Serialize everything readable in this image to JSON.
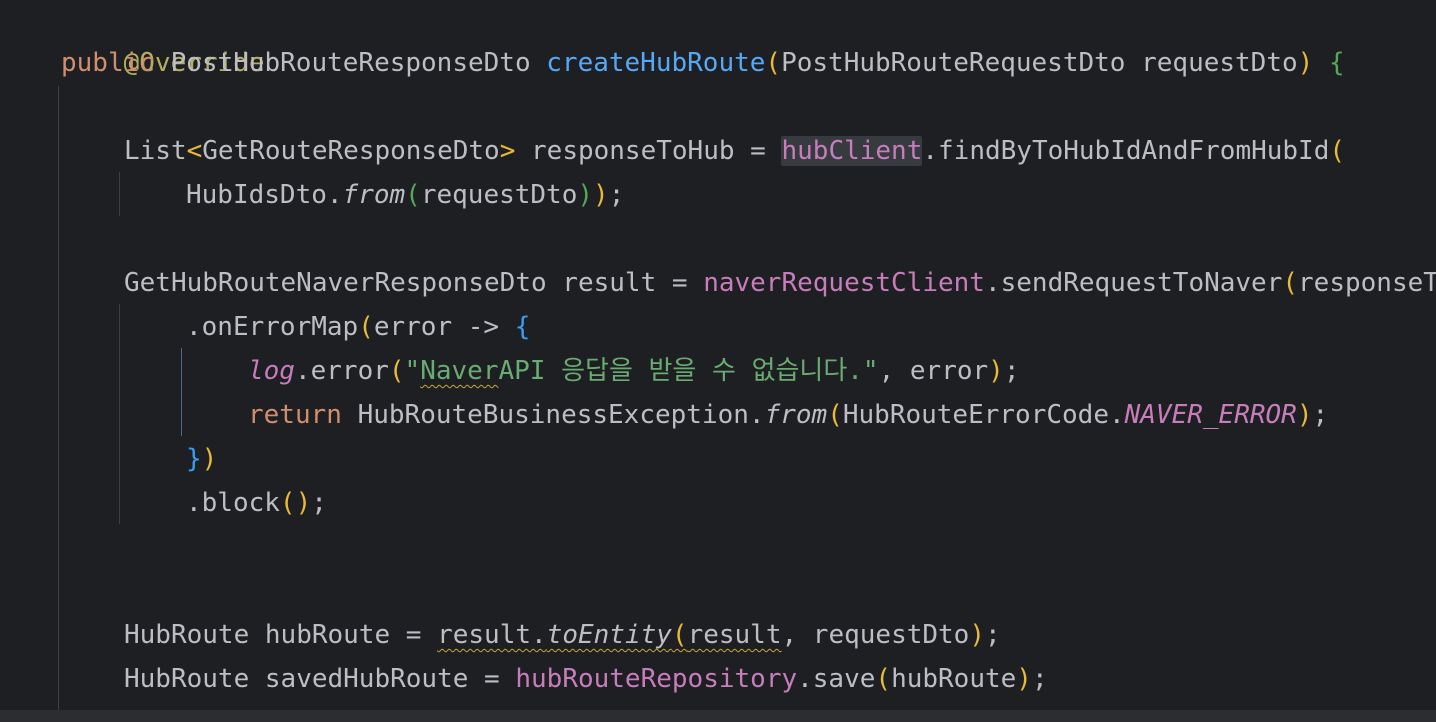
{
  "code": {
    "annotation": "@Override",
    "kw_public": "public",
    "kw_return": "return",
    "method_decl": {
      "return_type": "PostHubRouteResponseDto",
      "name": "createHubRoute",
      "param_type": "PostHubRouteRequestDto",
      "param_name": "requestDto"
    },
    "list_stmt": {
      "list_type": "List",
      "generic_type": "GetRouteResponseDto",
      "var_name": "responseToHub",
      "assign": "=",
      "client_field": "hubClient",
      "method": ".findByToHubIdAndFromHubId",
      "arg_class": "HubIdsDto.",
      "arg_static": "from",
      "arg_param": "requestDto"
    },
    "result_stmt": {
      "type": "GetHubRouteNaverResponseDto",
      "var_name": "result",
      "assign": "=",
      "client_field": "naverRequestClient",
      "method": ".sendRequestToNaver",
      "arg_cut": "responseTo"
    },
    "on_error_map": ".onErrorMap",
    "lambda_param": "error",
    "arrow": "->",
    "log_field": "log",
    "log_method": ".error",
    "log_string_prefix": "\"",
    "log_string_squiggle": "Naver",
    "log_string_rest": "API 응답을 받을 수 없습니다.\"",
    "log_arg": "error",
    "exception_class": "HubRouteBusinessException.",
    "exception_static": "from",
    "error_code_class": "HubRouteErrorCode.",
    "error_code_const": "NAVER_ERROR",
    "block_call": ".block",
    "entity_stmt": {
      "type": "HubRoute",
      "var_name": "hubRoute",
      "assign": "=",
      "receiver": "result.",
      "method": "toEntity",
      "arg_1": "result",
      "arg_2": "requestDto"
    },
    "save_stmt": {
      "type": "HubRoute",
      "var_name": "savedHubRoute",
      "assign": "=",
      "repo_field": "hubRouteRepository",
      "method": ".save",
      "arg": "hubRoute"
    }
  }
}
